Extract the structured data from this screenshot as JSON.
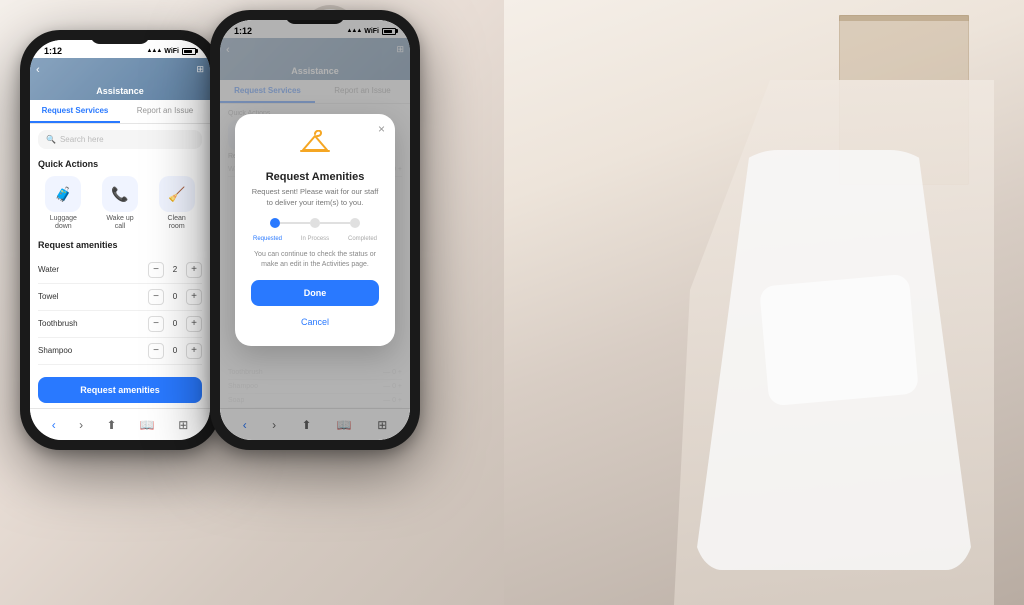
{
  "background": {
    "description": "Bathroom background with woman in white robe"
  },
  "phone1": {
    "status_bar": {
      "time": "1:12",
      "signal": "●●●",
      "wifi": "WiFi",
      "battery": "75%"
    },
    "header": {
      "title": "Assistance",
      "back_label": "‹",
      "icon_label": "⊞"
    },
    "tabs": [
      {
        "label": "Request Services",
        "active": true
      },
      {
        "label": "Report an Issue",
        "active": false
      }
    ],
    "search": {
      "placeholder": "Search here"
    },
    "quick_actions": {
      "title": "Quick Actions",
      "items": [
        {
          "label": "Luggage\ndown",
          "icon": "🧳"
        },
        {
          "label": "Wake up\ncall",
          "icon": "📞"
        },
        {
          "label": "Clean\nroom",
          "icon": "🧹"
        }
      ]
    },
    "amenities": {
      "title": "Request amenities",
      "items": [
        {
          "name": "Water",
          "count": 2
        },
        {
          "name": "Towel",
          "count": 0
        },
        {
          "name": "Toothbrush",
          "count": 0
        },
        {
          "name": "Shampoo",
          "count": 0
        }
      ],
      "request_btn_label": "Request amenities"
    },
    "bottom_nav": [
      "‹",
      "›",
      "⬆",
      "📖",
      "⊞"
    ]
  },
  "phone2": {
    "status_bar": {
      "time": "1:12",
      "signal": "●●●",
      "wifi": "WiFi",
      "battery": "75%"
    },
    "header": {
      "title": "Assistance",
      "back_label": "‹",
      "icon_label": "⊞"
    },
    "modal": {
      "close_label": "×",
      "icon": "🪝",
      "title": "Request Amenities",
      "subtitle": "Request sent! Please wait for our staff to deliver your item(s) to you.",
      "progress_steps": [
        {
          "label": "Requested",
          "active": true
        },
        {
          "label": "In Process",
          "active": false
        },
        {
          "label": "Completed",
          "active": false
        }
      ],
      "info_text": "You can continue to check the status or make an edit in the Activities page.",
      "done_btn_label": "Done",
      "cancel_btn_label": "Cancel"
    },
    "amenities_behind": {
      "items": [
        {
          "name": "Toothbrush",
          "count": 0
        },
        {
          "name": "Shampoo",
          "count": 0
        },
        {
          "name": "Soap",
          "count": 0
        }
      ]
    },
    "bottom_nav": [
      "‹",
      "›",
      "⬆",
      "📖",
      "⊞"
    ]
  }
}
